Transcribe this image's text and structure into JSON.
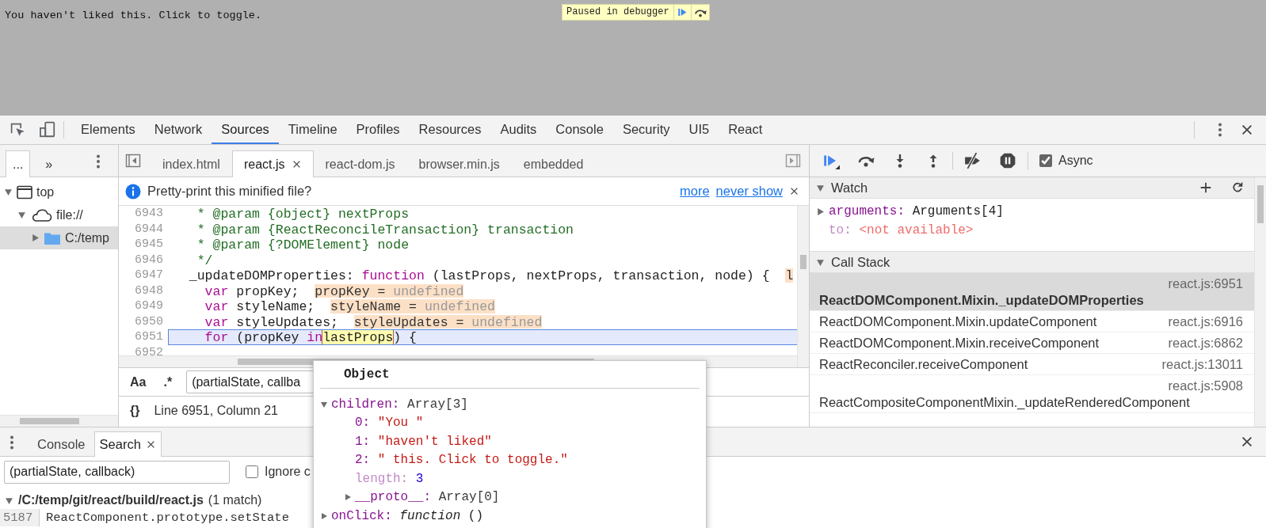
{
  "page": {
    "message": "You haven't liked this. Click to toggle.",
    "paused_overlay": {
      "label": "Paused in debugger"
    }
  },
  "toolbar": {
    "tabs": [
      {
        "label": "Elements",
        "selected": false
      },
      {
        "label": "Network",
        "selected": false
      },
      {
        "label": "Sources",
        "selected": true
      },
      {
        "label": "Timeline",
        "selected": false
      },
      {
        "label": "Profiles",
        "selected": false
      },
      {
        "label": "Resources",
        "selected": false
      },
      {
        "label": "Audits",
        "selected": false
      },
      {
        "label": "Console",
        "selected": false
      },
      {
        "label": "Security",
        "selected": false
      },
      {
        "label": "UI5",
        "selected": false
      },
      {
        "label": "React",
        "selected": false
      }
    ]
  },
  "navigator": {
    "tabs": [
      {
        "label": "...",
        "selected": true
      },
      {
        "label": "»",
        "selected": false
      }
    ],
    "tree": [
      {
        "label": "top",
        "kind": "frame",
        "expanded": true,
        "selected": false,
        "children": [
          {
            "label": "file://",
            "kind": "origin",
            "expanded": true,
            "selected": false,
            "children": [
              {
                "label": "C:/temp",
                "kind": "folder",
                "expanded": false,
                "selected": true
              }
            ]
          }
        ]
      }
    ]
  },
  "editor": {
    "tabs": [
      {
        "label": "index.html",
        "selected": false
      },
      {
        "label": "react.js",
        "selected": true
      },
      {
        "label": "react-dom.js",
        "selected": false
      },
      {
        "label": "browser.min.js",
        "selected": false
      },
      {
        "label": "embedded",
        "selected": false
      }
    ],
    "infobar": {
      "message": "Pretty-print this minified file?",
      "links": [
        "more",
        "never show"
      ]
    },
    "lines": [
      {
        "number": "6943",
        "selected": false,
        "tokens": [
          {
            "kind": "comment",
            "text": "   * @param {object} nextProps"
          }
        ]
      },
      {
        "number": "6944",
        "selected": false,
        "tokens": [
          {
            "kind": "comment",
            "text": "   * @param {ReactReconcileTransaction} transaction"
          }
        ]
      },
      {
        "number": "6945",
        "selected": false,
        "tokens": [
          {
            "kind": "comment",
            "text": "   * @param {?DOMElement} node"
          }
        ]
      },
      {
        "number": "6946",
        "selected": false,
        "tokens": [
          {
            "kind": "comment",
            "text": "   */"
          }
        ]
      },
      {
        "number": "6947",
        "selected": false,
        "tokens": [
          {
            "kind": "plain",
            "text": "  _updateDOMProperties: "
          },
          {
            "kind": "keyword",
            "text": "function"
          },
          {
            "kind": "plain",
            "text": " (lastProps, nextProps, transaction, node) {  "
          },
          {
            "kind": "inline_value",
            "text": "l"
          }
        ]
      },
      {
        "number": "6948",
        "selected": false,
        "tokens": [
          {
            "kind": "keyword",
            "text": "    var"
          },
          {
            "kind": "plain",
            "text": " propKey;  "
          },
          {
            "kind": "inline_value",
            "text": "propKey = ",
            "value": "undefined"
          }
        ]
      },
      {
        "number": "6949",
        "selected": false,
        "tokens": [
          {
            "kind": "keyword",
            "text": "    var"
          },
          {
            "kind": "plain",
            "text": " styleName;  "
          },
          {
            "kind": "inline_value",
            "text": "styleName = ",
            "value": "undefined"
          }
        ]
      },
      {
        "number": "6950",
        "selected": false,
        "tokens": [
          {
            "kind": "keyword",
            "text": "    var"
          },
          {
            "kind": "plain",
            "text": " styleUpdates;  "
          },
          {
            "kind": "inline_value",
            "text": "styleUpdates = ",
            "value": "undefined"
          }
        ]
      },
      {
        "number": "6951",
        "selected": true,
        "tokens": [
          {
            "kind": "keyword",
            "text": "    for"
          },
          {
            "kind": "plain",
            "text": " (propKey "
          },
          {
            "kind": "keyword",
            "text": "in"
          },
          {
            "kind": "hover",
            "text": "lastProps"
          },
          {
            "kind": "plain",
            "text": ") {"
          }
        ]
      },
      {
        "number": "6952",
        "selected": false
      }
    ],
    "search": {
      "case_label": "Aa",
      "regex_label": ".*",
      "value": "(partialState, callba"
    },
    "status": {
      "format_label": "{}",
      "position": "Line 6951, Column 21"
    }
  },
  "debugger": {
    "async": {
      "label": "Async",
      "checked": true
    },
    "watch": {
      "title": "Watch",
      "expanded": true,
      "items": [
        {
          "name": "arguments:",
          "value": "Arguments[4]",
          "expandable": true,
          "available": true
        },
        {
          "name": "to:",
          "value": "<not available>",
          "expandable": false,
          "available": false
        }
      ]
    },
    "call_stack": {
      "title": "Call Stack",
      "expanded": true,
      "frames": [
        {
          "function": "ReactDOMComponent.Mixin._updateDOMProperties",
          "location": "react.js:6951",
          "selected": true
        },
        {
          "function": "ReactDOMComponent.Mixin.updateComponent",
          "location": "react.js:6916",
          "selected": false
        },
        {
          "function": "ReactDOMComponent.Mixin.receiveComponent",
          "location": "react.js:6862",
          "selected": false
        },
        {
          "function": "ReactReconciler.receiveComponent",
          "location": "react.js:13011",
          "selected": false
        },
        {
          "function": "ReactCompositeComponentMixin._updateRenderedComponent",
          "location": "react.js:5908",
          "selected": false
        }
      ]
    }
  },
  "popover": {
    "title": "Object",
    "properties": [
      {
        "name": "children:",
        "value": "Array[3]",
        "kind": "object",
        "expanded": true,
        "children": [
          {
            "name": "0:",
            "value": "\"You \"",
            "kind": "string",
            "enumerable": true
          },
          {
            "name": "1:",
            "value": "\"haven't liked\"",
            "kind": "string",
            "enumerable": true
          },
          {
            "name": "2:",
            "value": "\" this. Click to toggle.\"",
            "kind": "string",
            "enumerable": true
          },
          {
            "name": "length:",
            "value": "3",
            "kind": "number",
            "enumerable": false
          },
          {
            "name": "__proto__:",
            "value": "Array[0]",
            "kind": "object",
            "expanded": false,
            "enumerable": true
          }
        ]
      },
      {
        "name": "onClick:",
        "value": "*function* ()",
        "kind": "function",
        "expanded": false
      }
    ]
  },
  "drawer": {
    "tabs": [
      {
        "label": "Console",
        "selected": false
      },
      {
        "label": "Search",
        "selected": true
      }
    ],
    "search": {
      "value": "(partialState, callback)",
      "ignore_case": {
        "label": "Ignore c",
        "checked": false
      }
    },
    "results": [
      {
        "file": "/C:/temp/git/react/build/react.js",
        "count": "(1 match)",
        "expanded": true,
        "matches": [
          {
            "line": "5187",
            "text": "ReactComponent.prototype.setState"
          }
        ]
      }
    ]
  }
}
